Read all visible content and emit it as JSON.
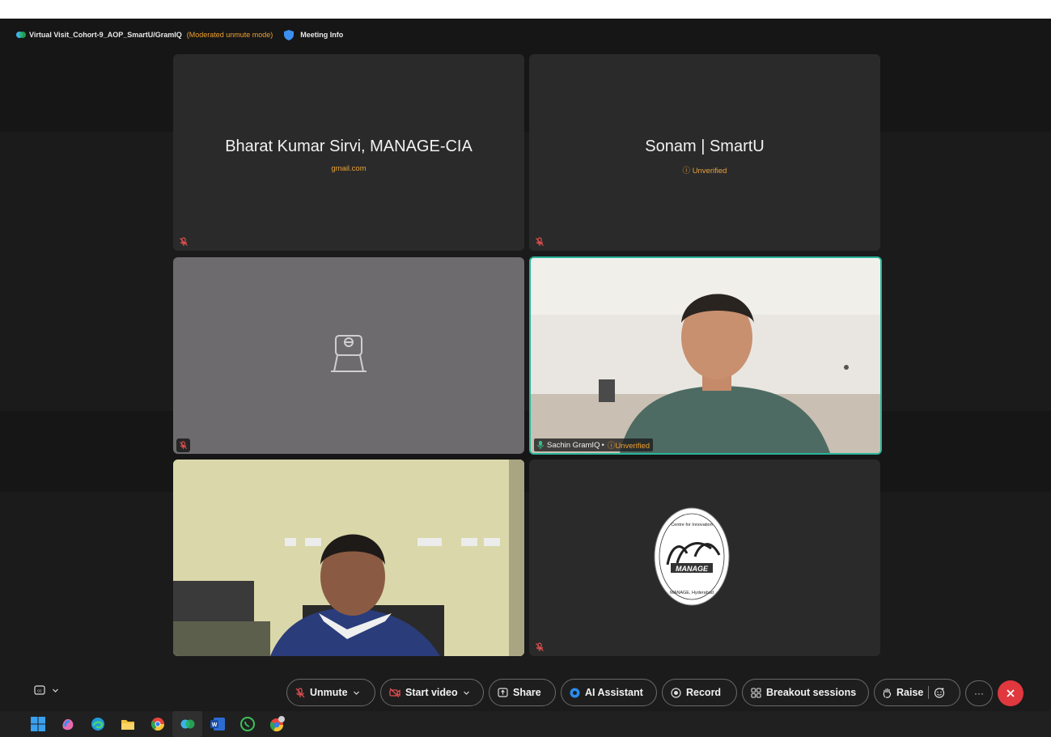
{
  "window": {
    "title": "Virtual Visit_Cohort-9_AOP_SmartU/GramIQ",
    "mode": "(Moderated unmute mode)",
    "meeting_info": "Meeting Info"
  },
  "tiles": [
    {
      "name": "Bharat Kumar Sirvi, MANAGE-CIA",
      "subtitle": "gmail.com"
    },
    {
      "name": "Sonam | SmartU",
      "subtitle": "Unverified"
    },
    {
      "name": ""
    },
    {
      "name": "Sachin GramIQ",
      "status": "Unverified",
      "separator": "•"
    },
    {
      "name": ""
    },
    {
      "logo_text": [
        "Centre for Innovation and Agripreneurship (CIA)",
        "MANAGE",
        "MANAGE, Hyderabad"
      ]
    }
  ],
  "toolbar": {
    "unmute": "Unmute",
    "start_video": "Start video",
    "share": "Share",
    "ai_assistant": "AI Assistant",
    "record": "Record",
    "breakout": "Breakout sessions",
    "raise": "Raise",
    "more": "···"
  },
  "taskbar": [
    "windows-start",
    "copilot",
    "edge",
    "file-explorer",
    "chrome",
    "webex",
    "word",
    "whatsapp",
    "chrome-profile"
  ],
  "colors": {
    "accent_orange": "#f0a030",
    "active_speaker_border": "#29b59a",
    "end_call": "#e0383f"
  }
}
